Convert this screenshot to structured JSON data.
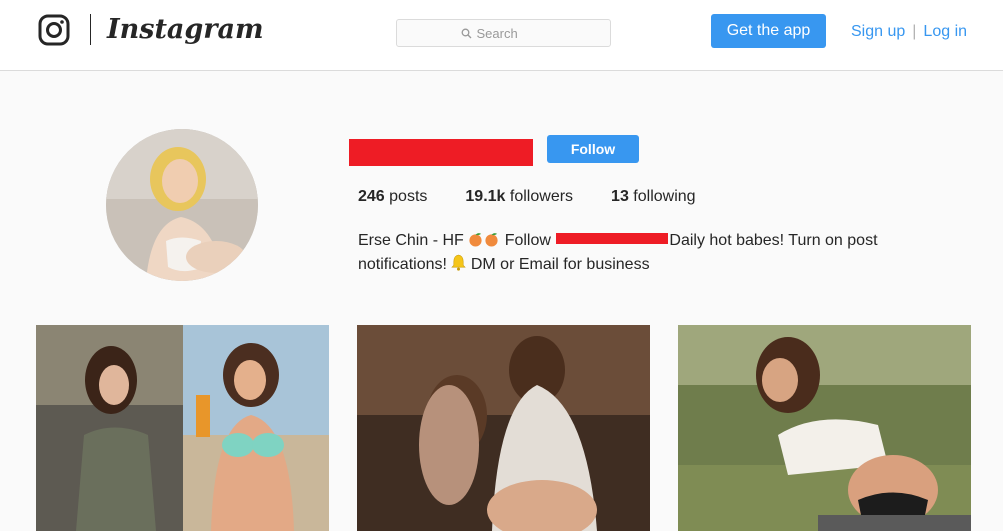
{
  "header": {
    "wordmark": "Instagram",
    "search_placeholder": "Search",
    "get_app_label": "Get the app",
    "signup_label": "Sign up",
    "separator": "|",
    "login_label": "Log in"
  },
  "profile": {
    "follow_label": "Follow",
    "stats": [
      {
        "count": "246",
        "label": "posts"
      },
      {
        "count": "19.1k",
        "label": "followers"
      },
      {
        "count": "13",
        "label": "following"
      }
    ],
    "bio": {
      "part1": "Erse Chin - HF",
      "part2": "Follow",
      "part3": "Daily hot babes! Turn on post",
      "part4": "notifications!",
      "part5": "DM or Email for business"
    }
  },
  "colors": {
    "accent": "#3897f0",
    "redaction": "#ee1c25"
  },
  "icons": [
    "instagram-glyph-icon",
    "search-icon",
    "peach-emoji-icon",
    "bell-emoji-icon"
  ],
  "posts": [
    {
      "id": "post-1"
    },
    {
      "id": "post-2"
    },
    {
      "id": "post-3"
    }
  ]
}
